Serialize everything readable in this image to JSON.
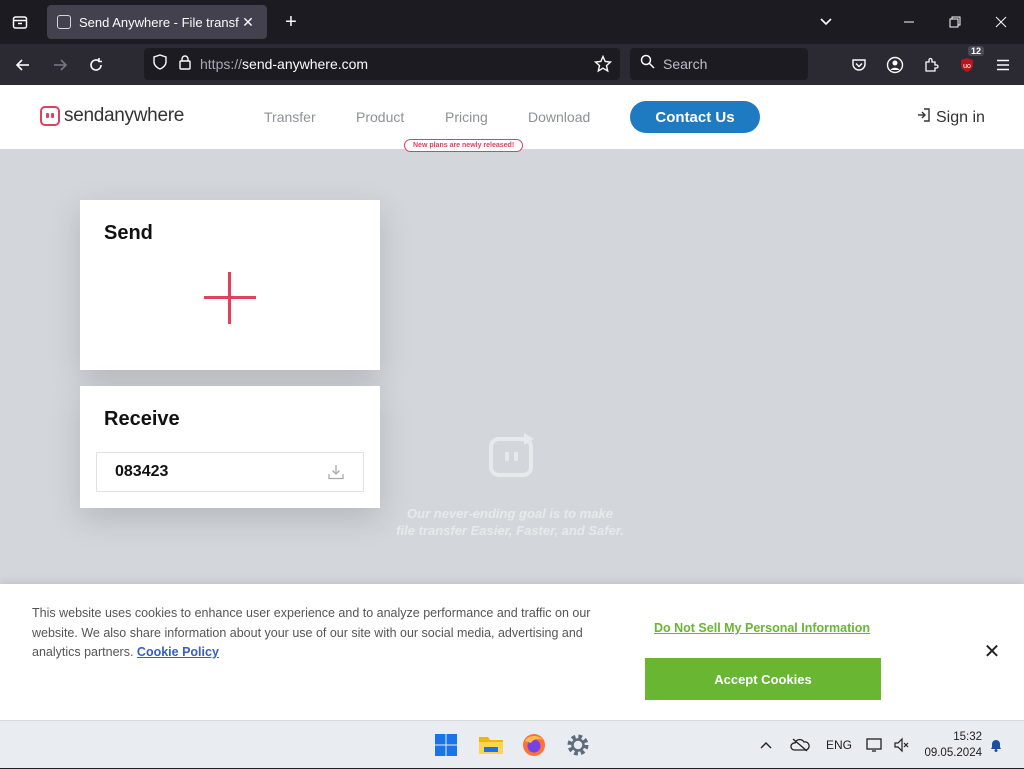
{
  "browser": {
    "tab_title": "Send Anywhere - File transfer",
    "url_scheme": "https://",
    "url_host": "send-anywhere.com",
    "search_placeholder": "Search",
    "extension_badge": "12"
  },
  "site": {
    "logo_part1": "send",
    "logo_part2": "anywhere",
    "menu": [
      "Transfer",
      "Product",
      "Pricing",
      "Download"
    ],
    "pricing_tip": "New plans are newly released!",
    "contact_label": "Contact Us",
    "signin_label": "Sign in",
    "accent": "#e2405c",
    "brand_blue": "#1f7bc1"
  },
  "send": {
    "title": "Send"
  },
  "receive": {
    "title": "Receive",
    "key_value": "083423"
  },
  "hero": {
    "line1": "Our never-ending goal is to make",
    "line2": "file transfer Easier, Faster, and Safer."
  },
  "cookie": {
    "text": "This website uses cookies to enhance user experience and to analyze performance and traffic on our website. We also share information about your use of our site with our social media, advertising and analytics partners.",
    "policy_link": "Cookie Policy",
    "dns_link": "Do Not Sell My Personal Information",
    "accept_label": "Accept Cookies",
    "accent": "#68b631"
  },
  "taskbar": {
    "language": "ENG",
    "time": "15:32",
    "date": "09.05.2024"
  }
}
